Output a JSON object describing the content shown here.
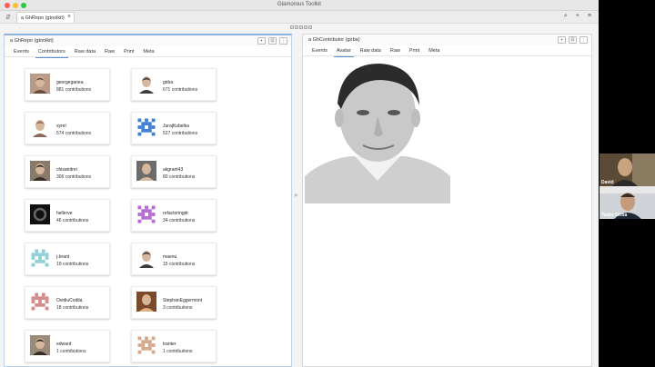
{
  "window": {
    "title": "Glamorous Toolkit"
  },
  "tab": {
    "label": "a GhRepo (gtoolkit)"
  },
  "left_pane": {
    "title": "a GhRepo (gtoolkit)",
    "tabs": [
      "Events",
      "Contributors",
      "Raw data",
      "Raw",
      "Print",
      "Meta"
    ],
    "active_tab": "Contributors",
    "contributors": [
      {
        "name": "georgeganea",
        "count": "881 contributions"
      },
      {
        "name": "girba",
        "count": "671 contributions"
      },
      {
        "name": "syrel",
        "count": "574 contributions"
      },
      {
        "name": "JurajKubelka",
        "count": "527 contributions"
      },
      {
        "name": "chisandrei",
        "count": "306 contributions"
      },
      {
        "name": "akgrant43",
        "count": "80 contributions"
      },
      {
        "name": "hellerve",
        "count": "46 contributions"
      },
      {
        "name": "refactoringdr",
        "count": "34 contributions"
      },
      {
        "name": "j-brant",
        "count": "19 contributions"
      },
      {
        "name": "maenu",
        "count": "15 contributions"
      },
      {
        "name": "OvidiuCodila",
        "count": "18 contributions"
      },
      {
        "name": "StephanEggermont",
        "count": "3 contributions"
      },
      {
        "name": "edward",
        "count": "1 contributions"
      },
      {
        "name": "tranter",
        "count": "1 contributions"
      }
    ]
  },
  "right_pane": {
    "title": "a GhContributor (girba)",
    "tabs": [
      "Events",
      "Avatar",
      "Raw data",
      "Raw",
      "Print",
      "Meta"
    ],
    "active_tab": "Avatar"
  },
  "participants": [
    {
      "name": "David"
    },
    {
      "name": "Tudor Gîrba"
    }
  ],
  "colors": {
    "accent": "#5a8fd0",
    "pane_border": "#8fb4e0"
  }
}
